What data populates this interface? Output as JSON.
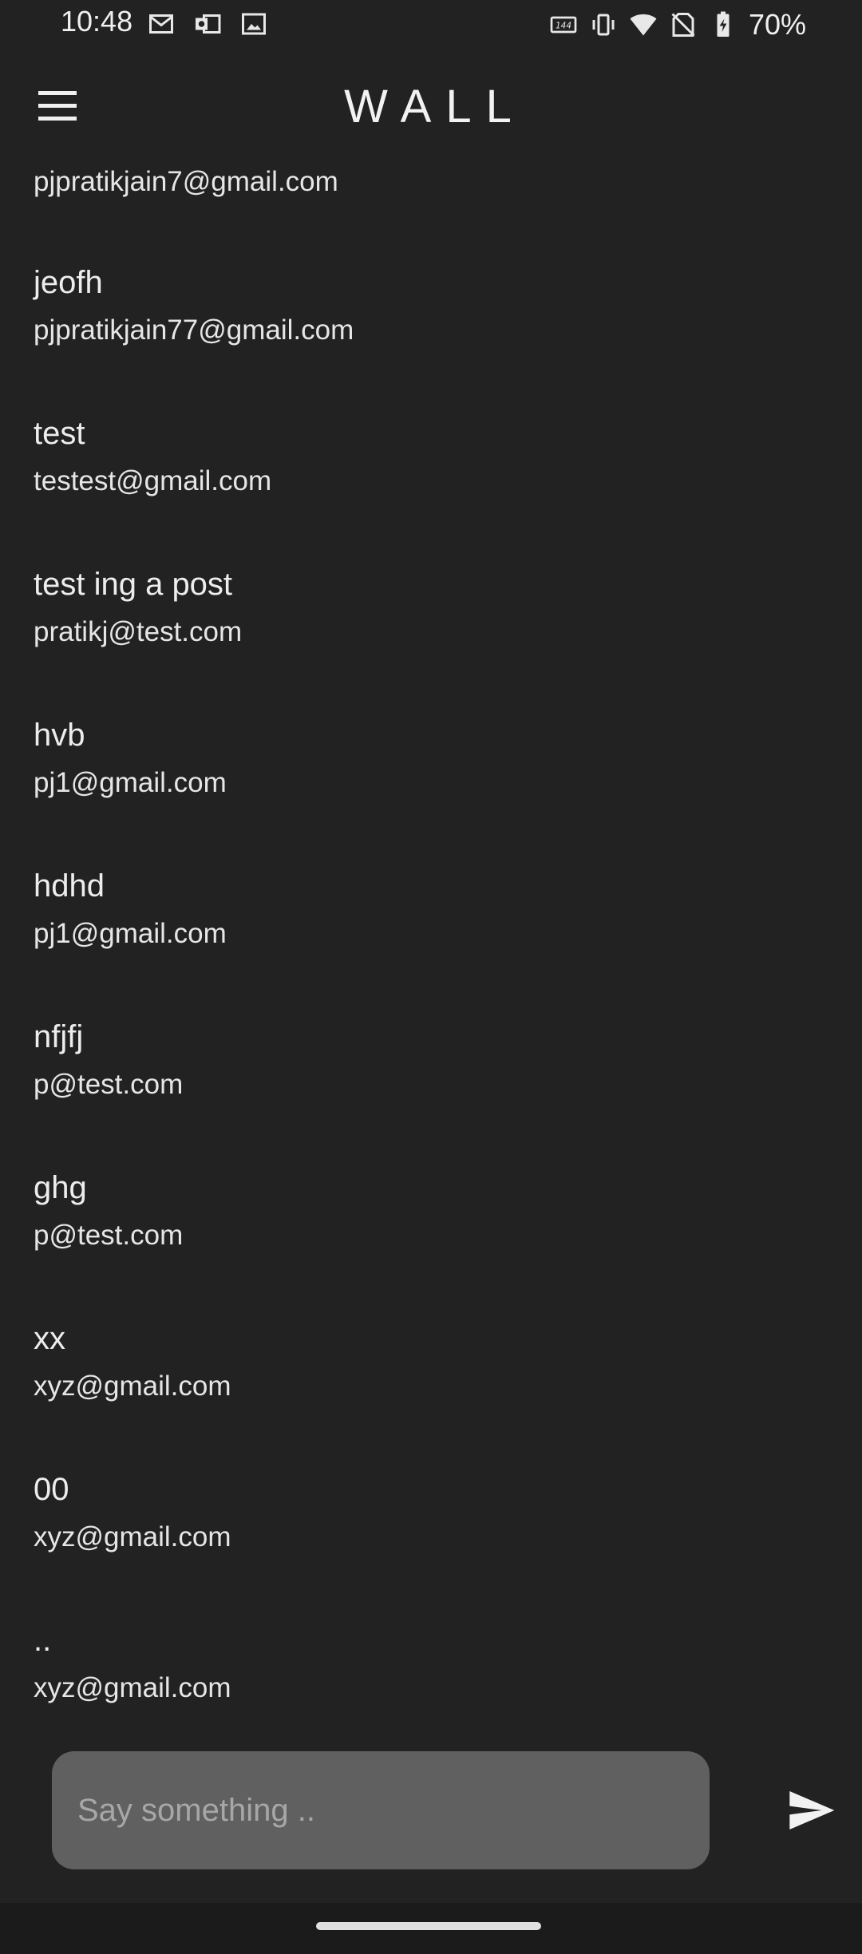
{
  "status_bar": {
    "time": "10:48",
    "battery_percent": "70%",
    "left_icons": [
      "gmail-icon",
      "outlook-icon",
      "gallery-icon"
    ],
    "right_icons": [
      "refresh-rate-144hz-icon",
      "vibrate-icon",
      "wifi-icon",
      "no-sim-icon",
      "battery-charging-icon"
    ]
  },
  "app_bar": {
    "title": "WALL",
    "menu_icon": "hamburger-menu-icon"
  },
  "posts": {
    "partial_top_email": "pjpratikjain7@gmail.com",
    "items": [
      {
        "title": "jeofh",
        "email": "pjpratikjain77@gmail.com"
      },
      {
        "title": "test",
        "email": "testest@gmail.com"
      },
      {
        "title": "test ing a post",
        "email": "pratikj@test.com"
      },
      {
        "title": "hvb",
        "email": "pj1@gmail.com"
      },
      {
        "title": "hdhd",
        "email": "pj1@gmail.com"
      },
      {
        "title": "nfjfj",
        "email": "p@test.com"
      },
      {
        "title": "ghg",
        "email": "p@test.com"
      },
      {
        "title": "xx",
        "email": "xyz@gmail.com"
      },
      {
        "title": "00",
        "email": "xyz@gmail.com"
      },
      {
        "title": "..",
        "email": "xyz@gmail.com"
      }
    ]
  },
  "composer": {
    "placeholder": "Say something ..",
    "send_icon": "send-icon"
  },
  "colors": {
    "background": "#222222",
    "input_background": "#606060",
    "text": "#e9e9e9"
  }
}
